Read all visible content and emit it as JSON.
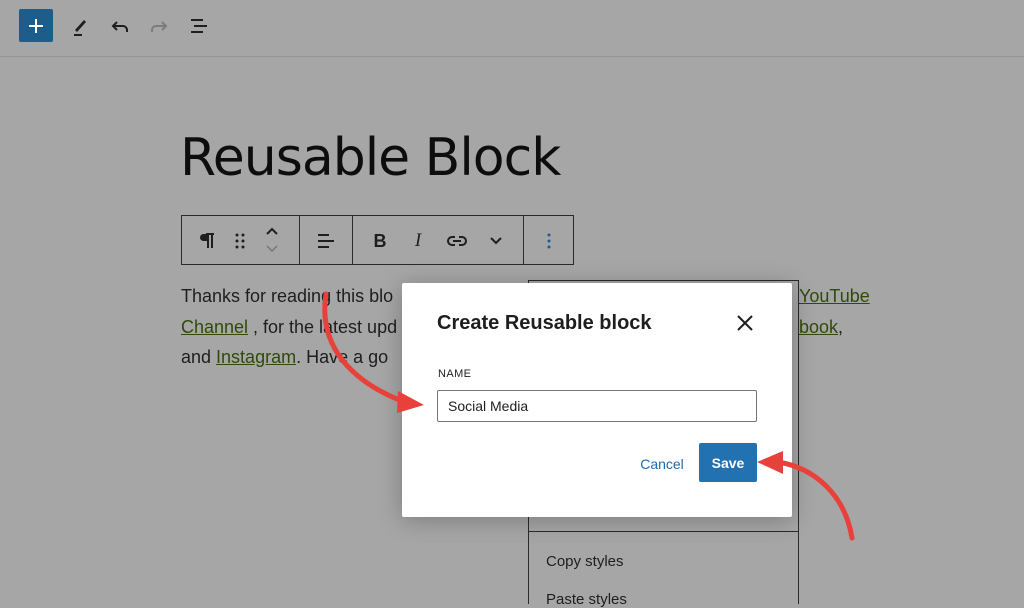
{
  "editor": {
    "title": "Reusable Block",
    "paragraph": {
      "line1_start": "Thanks for reading this blo",
      "line1_link": "YouTube",
      "line2_link": "Channel",
      "line2_mid": ", for the latest upd",
      "line2_end_link": "book",
      "line2_end": ",",
      "line3_start": "and ",
      "line3_link": "Instagram",
      "line3_end": ". Have a go"
    }
  },
  "top_toolbar": {
    "icons": [
      "plus-icon",
      "pencil-icon",
      "undo-icon",
      "redo-icon",
      "list-view-icon"
    ]
  },
  "block_toolbar": {
    "icons": [
      "paragraph-icon",
      "drag-handle-icon",
      "move-up-down-icon",
      "align-icon",
      "bold-icon",
      "italic-icon",
      "link-icon",
      "chevron-down-icon",
      "more-options-icon"
    ]
  },
  "options_menu": {
    "items": [
      "Copy styles",
      "Paste styles"
    ]
  },
  "modal": {
    "title": "Create Reusable block",
    "name_label": "NAME",
    "name_value": "Social Media",
    "cancel_label": "Cancel",
    "save_label": "Save"
  },
  "colors": {
    "primary": "#2271b1",
    "link": "#2f4a0a",
    "annotation_arrow": "#e8403a",
    "overlay": "#a6a6a6"
  }
}
